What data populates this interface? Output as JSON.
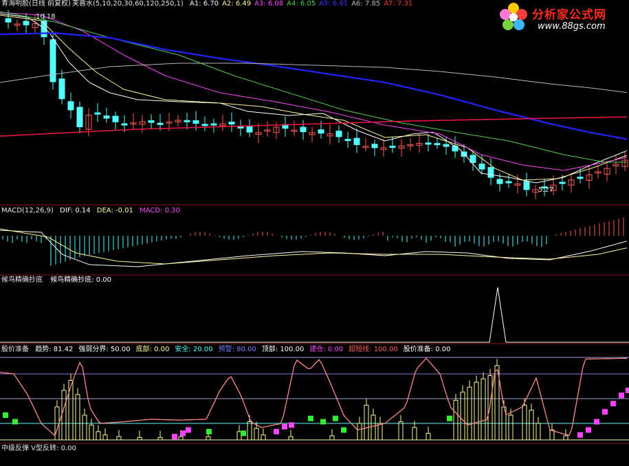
{
  "colors": {
    "background": "#000000",
    "panel_border": "#8a0f16",
    "candle_up": "#ff5a5a",
    "candle_down": "#54ffff",
    "ma_white": "#ffffff",
    "ma_yellow": "#fffb95",
    "ma_magenta": "#ff44ff",
    "ma_green": "#4bd34b",
    "ma_blue": "#2323ff",
    "ma_gray": "#b8b8b8",
    "ma_red": "#e8163e",
    "brand_red": "#ff2a1c"
  },
  "price_panel": {
    "security": "青海明胶(日线 前复权)",
    "indicator": "芙蓉水(5,10,20,30,60,120,250,1)",
    "ma_values": [
      {
        "label": "A1:",
        "value": "6.70",
        "color": "#ffffff"
      },
      {
        "label": "A2:",
        "value": "6.49",
        "color": "#fffb95"
      },
      {
        "label": "A3:",
        "value": "6.08",
        "color": "#ff44ff"
      },
      {
        "label": "A4:",
        "value": "6.05",
        "color": "#4bd34b"
      },
      {
        "label": "A5:",
        "value": "6.61",
        "color": "#3a3aff"
      },
      {
        "label": "A6:",
        "value": "7.85",
        "color": "#b8b8b8"
      },
      {
        "label": "A7:",
        "value": "7.31",
        "color": "#ff3030"
      }
    ],
    "high_label": "10.18",
    "low_label": "5.27"
  },
  "macd_panel": {
    "title": "MACD(12,26,9)",
    "dif": "DIF: 0.14",
    "dea": "DEA: -0.01",
    "macd": "MACD: 0.30"
  },
  "signal_panel": {
    "name": "候鸟精确抄底",
    "label": "候鸟精确抄底: 0.00"
  },
  "ready_panel": {
    "name": "股价准备",
    "items": [
      {
        "text": "趋势: 81.42",
        "color": "#ffffff"
      },
      {
        "text": "强弱分界: 50.00",
        "color": "#ffffff"
      },
      {
        "text": "底部: 0.00",
        "color": "#fffb95"
      },
      {
        "text": "安全: 20.00",
        "color": "#54ffff"
      },
      {
        "text": "预警: 80.00",
        "color": "#7b7bff"
      },
      {
        "text": "顶部: 100.00",
        "color": "#ffffff"
      },
      {
        "text": "建仓: 0.00",
        "color": "#ff44ff"
      },
      {
        "text": "超短线: 100.00",
        "color": "#ff5a5a"
      },
      {
        "text": "股价准备: 0.00",
        "color": "#ffffff"
      }
    ]
  },
  "bottom_panel": {
    "label": "中级反弹  V型反转: 0.00"
  },
  "logo": {
    "title": "分析家公式网",
    "url": "www.88gs.com"
  },
  "chart_data": [
    {
      "type": "candlestick",
      "title": "青海明胶(日线 前复权) 芙蓉水(5,10,20,30,60,120,250,1)",
      "series": [
        {
          "name": "A1",
          "last": 6.7
        },
        {
          "name": "A2",
          "last": 6.49
        },
        {
          "name": "A3",
          "last": 6.08
        },
        {
          "name": "A4",
          "last": 6.05
        },
        {
          "name": "A5",
          "last": 6.61
        },
        {
          "name": "A6",
          "last": 7.85
        },
        {
          "name": "A7",
          "last": 7.31
        }
      ],
      "annotations": [
        "10.18",
        "5.27"
      ],
      "ylim": [
        5.0,
        10.4
      ]
    },
    {
      "type": "bar",
      "title": "MACD(12,26,9)",
      "series": [
        {
          "name": "DIF",
          "last": 0.14
        },
        {
          "name": "DEA",
          "last": -0.01
        },
        {
          "name": "MACD",
          "last": 0.3
        }
      ]
    },
    {
      "type": "line",
      "title": "候鸟精确抄底",
      "series": [
        {
          "name": "候鸟精确抄底",
          "last": 0.0
        }
      ]
    },
    {
      "type": "line",
      "title": "股价准备",
      "series": [
        {
          "name": "趋势",
          "last": 81.42
        },
        {
          "name": "强弱分界",
          "last": 50.0
        },
        {
          "name": "底部",
          "last": 0.0
        },
        {
          "name": "安全",
          "last": 20.0
        },
        {
          "name": "预警",
          "last": 80.0
        },
        {
          "name": "顶部",
          "last": 100.0
        },
        {
          "name": "建仓",
          "last": 0.0
        },
        {
          "name": "超短线",
          "last": 100.0
        },
        {
          "name": "股价准备",
          "last": 0.0
        }
      ],
      "ylim": [
        0,
        100
      ]
    },
    {
      "type": "line",
      "title": "中级反弹",
      "series": [
        {
          "name": "V型反转",
          "last": 0.0
        }
      ]
    }
  ]
}
